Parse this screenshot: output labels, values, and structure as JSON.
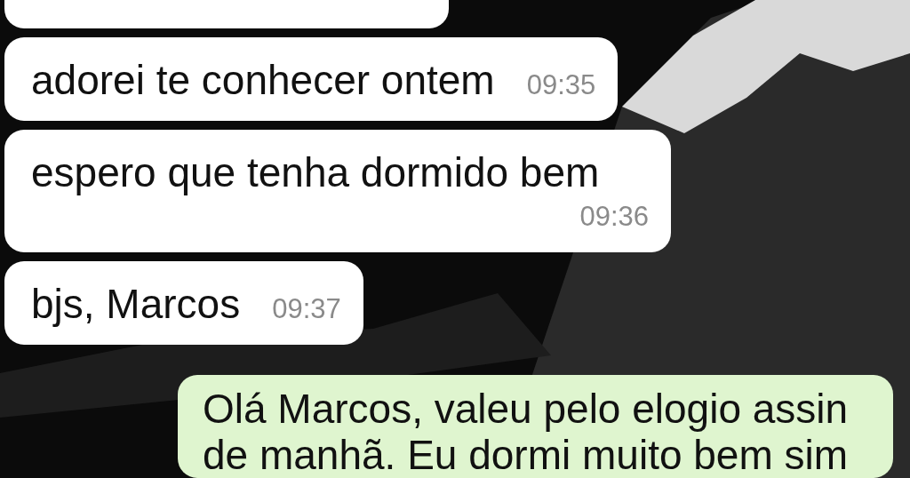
{
  "messages": [
    {
      "kind": "incoming"
    },
    {
      "kind": "incoming",
      "text": "adorei te conhecer ontem",
      "time": "09:35"
    },
    {
      "kind": "incoming",
      "text": "espero que tenha dormido bem",
      "time": "09:36"
    },
    {
      "kind": "incoming",
      "text": "bjs, Marcos",
      "time": "09:37"
    },
    {
      "kind": "outgoing",
      "text": "Olá Marcos, valeu pelo elogio assin de manhã. Eu dormi muito bem sim"
    }
  ]
}
